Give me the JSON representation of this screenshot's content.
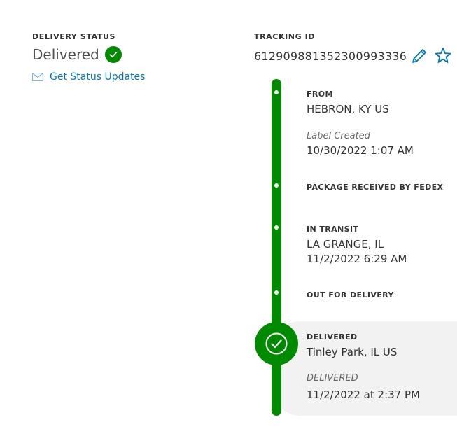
{
  "delivery_status": {
    "label": "DELIVERY STATUS",
    "value": "Delivered",
    "updates_link": "Get Status Updates"
  },
  "tracking": {
    "label": "TRACKING ID",
    "number": "612909881352300993336"
  },
  "timeline": {
    "from_label": "FROM",
    "from_location": "HEBRON, KY US",
    "label_created": "Label Created",
    "label_created_date": "10/30/2022 1:07 AM",
    "received": "PACKAGE RECEIVED BY FEDEX",
    "in_transit_label": "IN TRANSIT",
    "in_transit_location": "LA GRANGE, IL",
    "in_transit_date": "11/2/2022 6:29 AM",
    "out_for_delivery": "OUT FOR DELIVERY",
    "delivered_label": "DELIVERED",
    "delivered_location": "Tinley Park, IL US",
    "delivered_status": "DELIVERED",
    "delivered_date": "11/2/2022 at 2:37 PM"
  },
  "colors": {
    "accent_green": "#008a00",
    "link_blue": "#007ab7",
    "panel_gray": "#f2f2f2"
  },
  "icons": [
    "check-circle-icon",
    "envelope-icon",
    "pencil-icon",
    "star-icon",
    "delivered-check-icon"
  ]
}
